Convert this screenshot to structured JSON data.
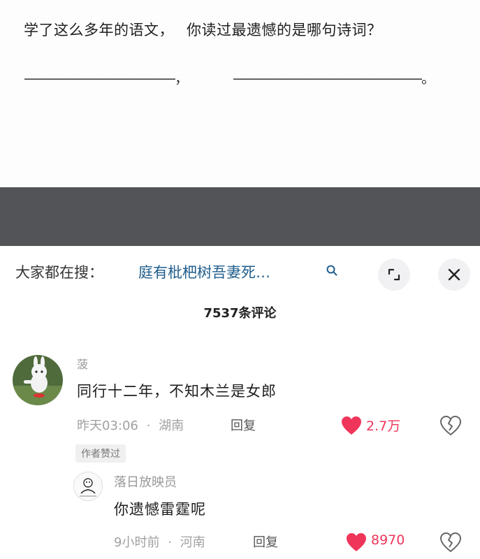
{
  "post": {
    "question_part1": "学了这么多年的语文，",
    "question_part2": "你读过最遗憾的是哪句诗词？",
    "blank1": "————————————，",
    "blank2": "———————————————。"
  },
  "search": {
    "prefix": "大家都在搜：",
    "query": "庭有枇杷树吾妻死…"
  },
  "comments_header": {
    "count_label": "7537条评论"
  },
  "comments": [
    {
      "username": "菠",
      "text": "同行十二年，不知木兰是女郎",
      "time": "昨天03:06",
      "separator": "·",
      "location": "湖南",
      "reply_label": "回复",
      "likes": "2.7万",
      "badge": "作者赞过"
    },
    {
      "username": "落日放映员",
      "text": "你遗憾雷霆呢",
      "time": "9小时前",
      "separator": "·",
      "location": "河南",
      "reply_label": "回复",
      "likes": "8970"
    }
  ],
  "colors": {
    "like_red": "#f0355b",
    "search_blue": "#1f5d8c",
    "dark_band": "#525457"
  },
  "icons": [
    "search-icon",
    "expand-icon",
    "close-icon",
    "heart-icon",
    "dislike-icon"
  ]
}
